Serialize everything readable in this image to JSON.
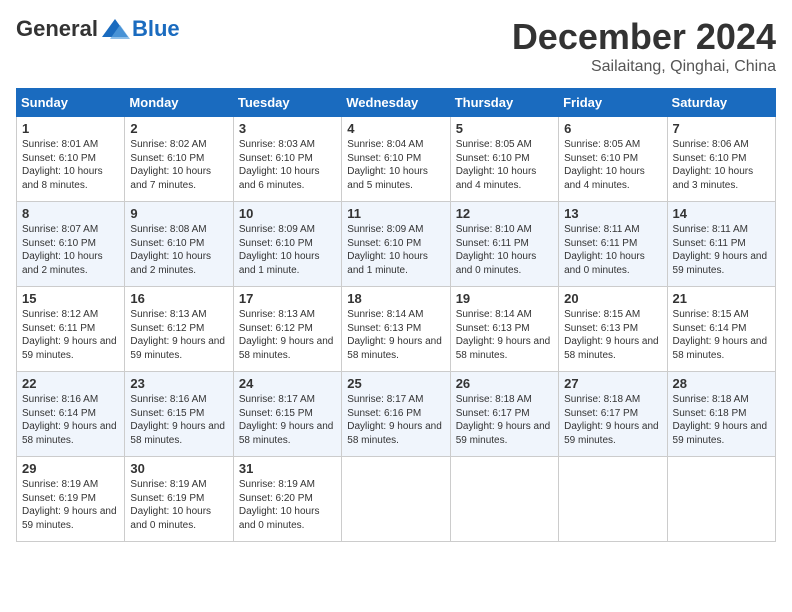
{
  "logo": {
    "general": "General",
    "blue": "Blue"
  },
  "title": "December 2024",
  "subtitle": "Sailaitang, Qinghai, China",
  "headers": [
    "Sunday",
    "Monday",
    "Tuesday",
    "Wednesday",
    "Thursday",
    "Friday",
    "Saturday"
  ],
  "weeks": [
    [
      {
        "day": "1",
        "sunrise": "8:01 AM",
        "sunset": "6:10 PM",
        "daylight": "10 hours and 8 minutes."
      },
      {
        "day": "2",
        "sunrise": "8:02 AM",
        "sunset": "6:10 PM",
        "daylight": "10 hours and 7 minutes."
      },
      {
        "day": "3",
        "sunrise": "8:03 AM",
        "sunset": "6:10 PM",
        "daylight": "10 hours and 6 minutes."
      },
      {
        "day": "4",
        "sunrise": "8:04 AM",
        "sunset": "6:10 PM",
        "daylight": "10 hours and 5 minutes."
      },
      {
        "day": "5",
        "sunrise": "8:05 AM",
        "sunset": "6:10 PM",
        "daylight": "10 hours and 4 minutes."
      },
      {
        "day": "6",
        "sunrise": "8:05 AM",
        "sunset": "6:10 PM",
        "daylight": "10 hours and 4 minutes."
      },
      {
        "day": "7",
        "sunrise": "8:06 AM",
        "sunset": "6:10 PM",
        "daylight": "10 hours and 3 minutes."
      }
    ],
    [
      {
        "day": "8",
        "sunrise": "8:07 AM",
        "sunset": "6:10 PM",
        "daylight": "10 hours and 2 minutes."
      },
      {
        "day": "9",
        "sunrise": "8:08 AM",
        "sunset": "6:10 PM",
        "daylight": "10 hours and 2 minutes."
      },
      {
        "day": "10",
        "sunrise": "8:09 AM",
        "sunset": "6:10 PM",
        "daylight": "10 hours and 1 minute."
      },
      {
        "day": "11",
        "sunrise": "8:09 AM",
        "sunset": "6:10 PM",
        "daylight": "10 hours and 1 minute."
      },
      {
        "day": "12",
        "sunrise": "8:10 AM",
        "sunset": "6:11 PM",
        "daylight": "10 hours and 0 minutes."
      },
      {
        "day": "13",
        "sunrise": "8:11 AM",
        "sunset": "6:11 PM",
        "daylight": "10 hours and 0 minutes."
      },
      {
        "day": "14",
        "sunrise": "8:11 AM",
        "sunset": "6:11 PM",
        "daylight": "9 hours and 59 minutes."
      }
    ],
    [
      {
        "day": "15",
        "sunrise": "8:12 AM",
        "sunset": "6:11 PM",
        "daylight": "9 hours and 59 minutes."
      },
      {
        "day": "16",
        "sunrise": "8:13 AM",
        "sunset": "6:12 PM",
        "daylight": "9 hours and 59 minutes."
      },
      {
        "day": "17",
        "sunrise": "8:13 AM",
        "sunset": "6:12 PM",
        "daylight": "9 hours and 58 minutes."
      },
      {
        "day": "18",
        "sunrise": "8:14 AM",
        "sunset": "6:13 PM",
        "daylight": "9 hours and 58 minutes."
      },
      {
        "day": "19",
        "sunrise": "8:14 AM",
        "sunset": "6:13 PM",
        "daylight": "9 hours and 58 minutes."
      },
      {
        "day": "20",
        "sunrise": "8:15 AM",
        "sunset": "6:13 PM",
        "daylight": "9 hours and 58 minutes."
      },
      {
        "day": "21",
        "sunrise": "8:15 AM",
        "sunset": "6:14 PM",
        "daylight": "9 hours and 58 minutes."
      }
    ],
    [
      {
        "day": "22",
        "sunrise": "8:16 AM",
        "sunset": "6:14 PM",
        "daylight": "9 hours and 58 minutes."
      },
      {
        "day": "23",
        "sunrise": "8:16 AM",
        "sunset": "6:15 PM",
        "daylight": "9 hours and 58 minutes."
      },
      {
        "day": "24",
        "sunrise": "8:17 AM",
        "sunset": "6:15 PM",
        "daylight": "9 hours and 58 minutes."
      },
      {
        "day": "25",
        "sunrise": "8:17 AM",
        "sunset": "6:16 PM",
        "daylight": "9 hours and 58 minutes."
      },
      {
        "day": "26",
        "sunrise": "8:18 AM",
        "sunset": "6:17 PM",
        "daylight": "9 hours and 59 minutes."
      },
      {
        "day": "27",
        "sunrise": "8:18 AM",
        "sunset": "6:17 PM",
        "daylight": "9 hours and 59 minutes."
      },
      {
        "day": "28",
        "sunrise": "8:18 AM",
        "sunset": "6:18 PM",
        "daylight": "9 hours and 59 minutes."
      }
    ],
    [
      {
        "day": "29",
        "sunrise": "8:19 AM",
        "sunset": "6:19 PM",
        "daylight": "9 hours and 59 minutes."
      },
      {
        "day": "30",
        "sunrise": "8:19 AM",
        "sunset": "6:19 PM",
        "daylight": "10 hours and 0 minutes."
      },
      {
        "day": "31",
        "sunrise": "8:19 AM",
        "sunset": "6:20 PM",
        "daylight": "10 hours and 0 minutes."
      },
      null,
      null,
      null,
      null
    ]
  ]
}
